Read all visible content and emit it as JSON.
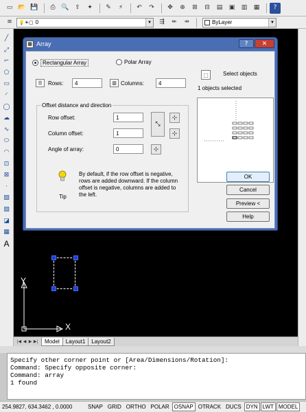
{
  "toolbar": {
    "layer_value": "0",
    "bylayer_value": "ByLayer"
  },
  "dialog": {
    "title": "Array",
    "rect_radio": "Rectangular Array",
    "polar_radio": "Polar Array",
    "rows_label": "Rows:",
    "rows_value": "4",
    "columns_label": "Columns:",
    "columns_value": "4",
    "offset_group": "Offset distance and direction",
    "row_offset_label": "Row offset:",
    "row_offset_value": "1",
    "column_offset_label": "Column offset:",
    "column_offset_value": "1",
    "angle_label": "Angle of array:",
    "angle_value": "0",
    "tip_text": "By default, if the row offset is negative, rows are added downward.  If the column offset is negative, columns are added to the left.",
    "tip_label": "Tip",
    "select_objects": "Select objects",
    "selected_count": "1 objects selected",
    "ok": "OK",
    "cancel": "Cancel",
    "preview": "Preview <",
    "help": "Help"
  },
  "layout_tabs": [
    "Model",
    "Layout1",
    "Layout2"
  ],
  "ucs": {
    "x_label": "X",
    "y_label": "Y"
  },
  "command_lines": [
    "Specify other corner point or [Area/Dimensions/Rotation]:",
    "Command: Specify opposite corner:",
    "Command: array",
    "1 found"
  ],
  "status": {
    "coords": "254.9827, 634.3462 , 0.0000",
    "toggles": [
      "SNAP",
      "GRID",
      "ORTHO",
      "POLAR",
      "OSNAP",
      "OTRACK",
      "DUCS",
      "DYN",
      "LWT",
      "MODEL"
    ],
    "toggles_on": [
      "OSNAP",
      "DYN",
      "LWT",
      "MODEL"
    ]
  }
}
